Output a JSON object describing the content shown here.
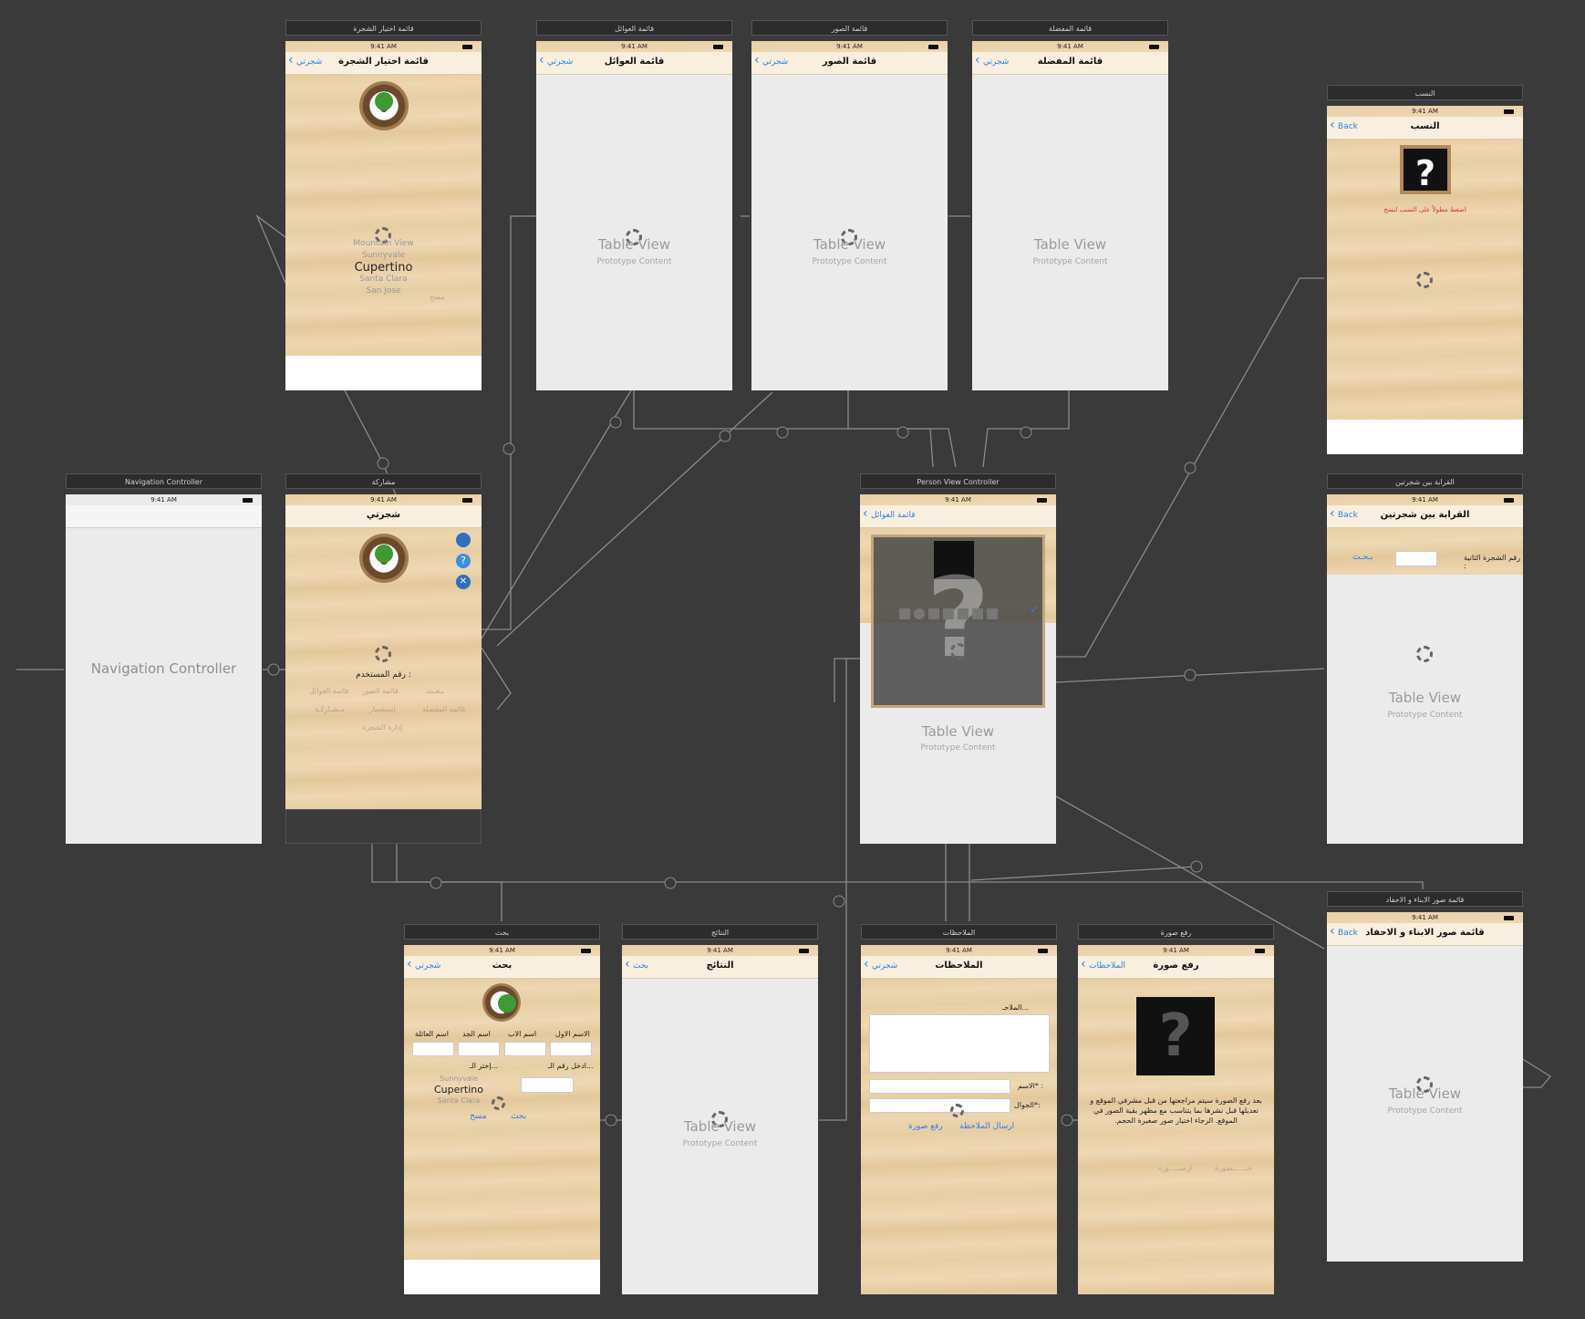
{
  "status_time": "9:41 AM",
  "back_home": "شجرتي",
  "back_en": "Back",
  "tv_title": "Table View",
  "tv_sub": "Prototype Content",
  "picker": [
    "Mountain View",
    "Sunnyvale",
    "Cupertino",
    "Santa Clara",
    "San Jose"
  ],
  "picker_faint": "مسح",
  "scenes": {
    "tree_select": {
      "label": "قائمة اختيار الشجرة",
      "title": "قائمة اختيار الشجرة"
    },
    "families": {
      "label": "قائمة العوائل",
      "title": "قائمة العوائل"
    },
    "photos": {
      "label": "قائمة الصور",
      "title": "قائمة الصور"
    },
    "favorites": {
      "label": "قائمة المفضلة",
      "title": "قائمة المفضلة"
    },
    "lineage": {
      "label": "النسب",
      "title": "النسب",
      "hint": "اضغط مطولاً على النسب لنسخ"
    },
    "nav": {
      "label": "Navigation Controller",
      "center": "Navigation Controller"
    },
    "share": {
      "label": "مشاركة",
      "title": "شجرتي",
      "user_no": "رقم المستخدم :",
      "menu": [
        "بـحـث",
        "قائمة الصور",
        "قائمة العوائل",
        "قائمة المفضلة",
        "إستفسار",
        "مـشـاركـة",
        "إدارة الشجرة"
      ]
    },
    "person": {
      "label": "Person View Controller",
      "back": "قائمة العوائل"
    },
    "kinship": {
      "label": "القرابة بين شجرتين",
      "title": "القرابة بين شجرتين",
      "field_label": "رقم الشجرة الثانية :",
      "search": "بـحـث"
    },
    "grandkids": {
      "label": "قائمة صور الابناء و الاحفاد",
      "title": "قائمة صور الابناء و الاحفاد"
    },
    "search": {
      "label": "بحث",
      "title": "بحث",
      "cols": [
        "الاسم الاول",
        "اسم الاب",
        "اسم الجد",
        "اسم العائلة"
      ],
      "choose": "إختر الـ...",
      "enter_no": "ادخل رقم الـ...",
      "picker": [
        "Sunnyvale",
        "Cupertino",
        "Santa Clara"
      ],
      "clear": "مسح",
      "search": "بحث"
    },
    "results": {
      "label": "النتائج",
      "title": "النتائج",
      "back": "بحث"
    },
    "notes": {
      "label": "الملاحظات",
      "title": "الملاحظات",
      "placeholder": "الملاحـ...",
      "name_label": "الاسم* :",
      "mobile_label": "الجوال*:",
      "send": "ارسال الملاحظة",
      "upload": "رفع صورة"
    },
    "upload": {
      "label": "رفع صورة",
      "title": "رفع صورة",
      "back": "الملاحظات",
      "desc": "بعد رفع الصورة سيتم مراجعتها من قبل مشرفي الموقع و تعديلها قبل نشرها بما يتناسب مع مظهر بقية الصور في الموقع. الرجاء اختيار صور صغيرة الحجم.",
      "faint_left": "ارســ...ورة",
      "faint_right": "حــ...ــصورة"
    }
  }
}
